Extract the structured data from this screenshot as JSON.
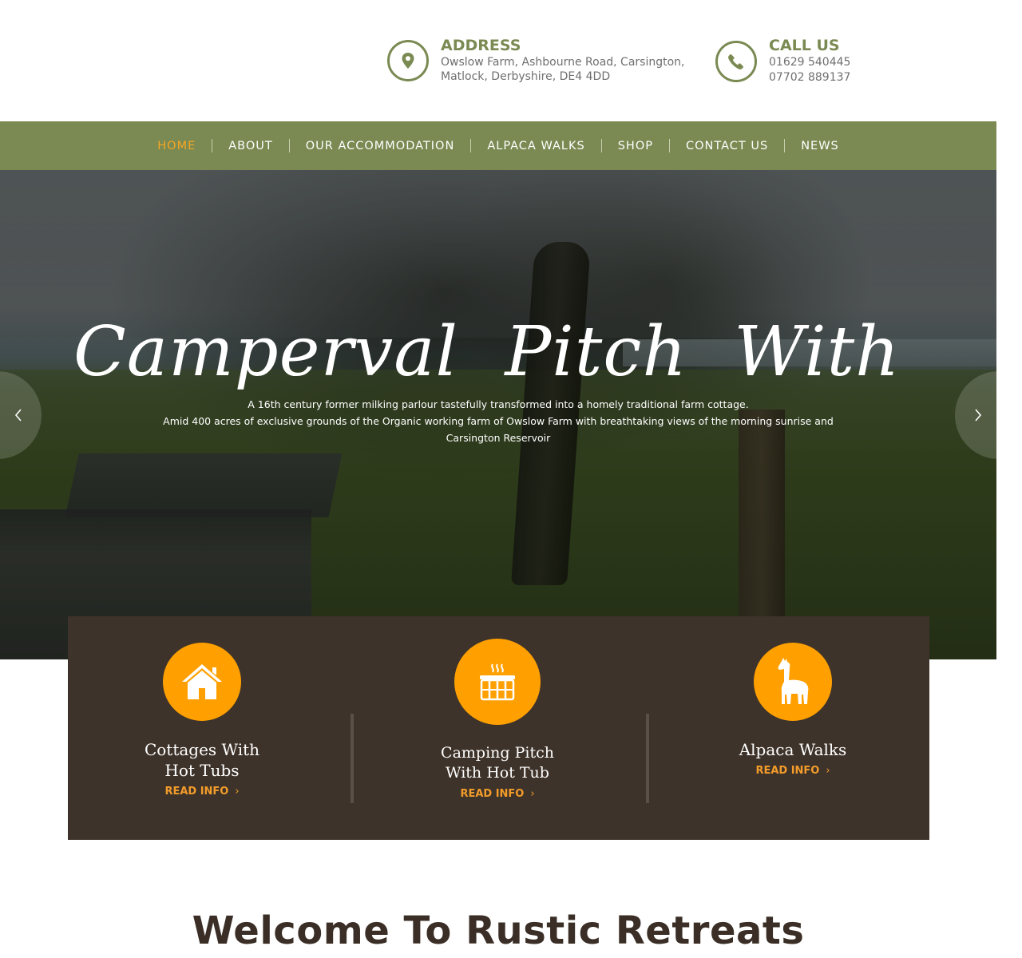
{
  "header": {
    "address": {
      "icon": "map-pin-icon",
      "heading": "ADDRESS",
      "line1": "Owslow Farm, Ashbourne Road, Carsington,",
      "line2": "Matlock, Derbyshire, DE4 4DD"
    },
    "call": {
      "icon": "phone-icon",
      "heading": "CALL US",
      "phone1": "01629 540445",
      "phone2": "07702 889137"
    }
  },
  "nav": {
    "items": [
      {
        "label": "HOME",
        "active": true
      },
      {
        "label": "ABOUT"
      },
      {
        "label": "OUR ACCOMMODATION"
      },
      {
        "label": "ALPACA WALKS"
      },
      {
        "label": "SHOP"
      },
      {
        "label": "CONTACT US"
      },
      {
        "label": "NEWS"
      }
    ]
  },
  "hero": {
    "title": "Camperval Pitch With",
    "subtitle_line1": "A 16th century former milking parlour tastefully transformed into a homely traditional farm cottage.",
    "subtitle_line2": "Amid 400 acres of exclusive grounds of the Organic working farm of Owslow Farm with breathtaking views of the morning sunrise and Carsington Reservoir",
    "prev_icon": "chevron-left-icon",
    "next_icon": "chevron-right-icon"
  },
  "features": [
    {
      "icon": "house-icon",
      "title_line1": "Cottages With",
      "title_line2": "Hot Tubs",
      "link": "READ INFO"
    },
    {
      "icon": "hot-tub-icon",
      "title_line1": "Camping Pitch",
      "title_line2": "With Hot Tub",
      "link": "READ INFO"
    },
    {
      "icon": "alpaca-icon",
      "title_line1": "Alpaca Walks",
      "link": "READ INFO"
    }
  ],
  "welcome": {
    "heading": "Welcome To Rustic Retreats"
  },
  "colors": {
    "brand_green": "#7a8a52",
    "accent_orange": "#ffa000",
    "panel_brown": "#3e332a",
    "heading_brown": "#3a2e26"
  }
}
